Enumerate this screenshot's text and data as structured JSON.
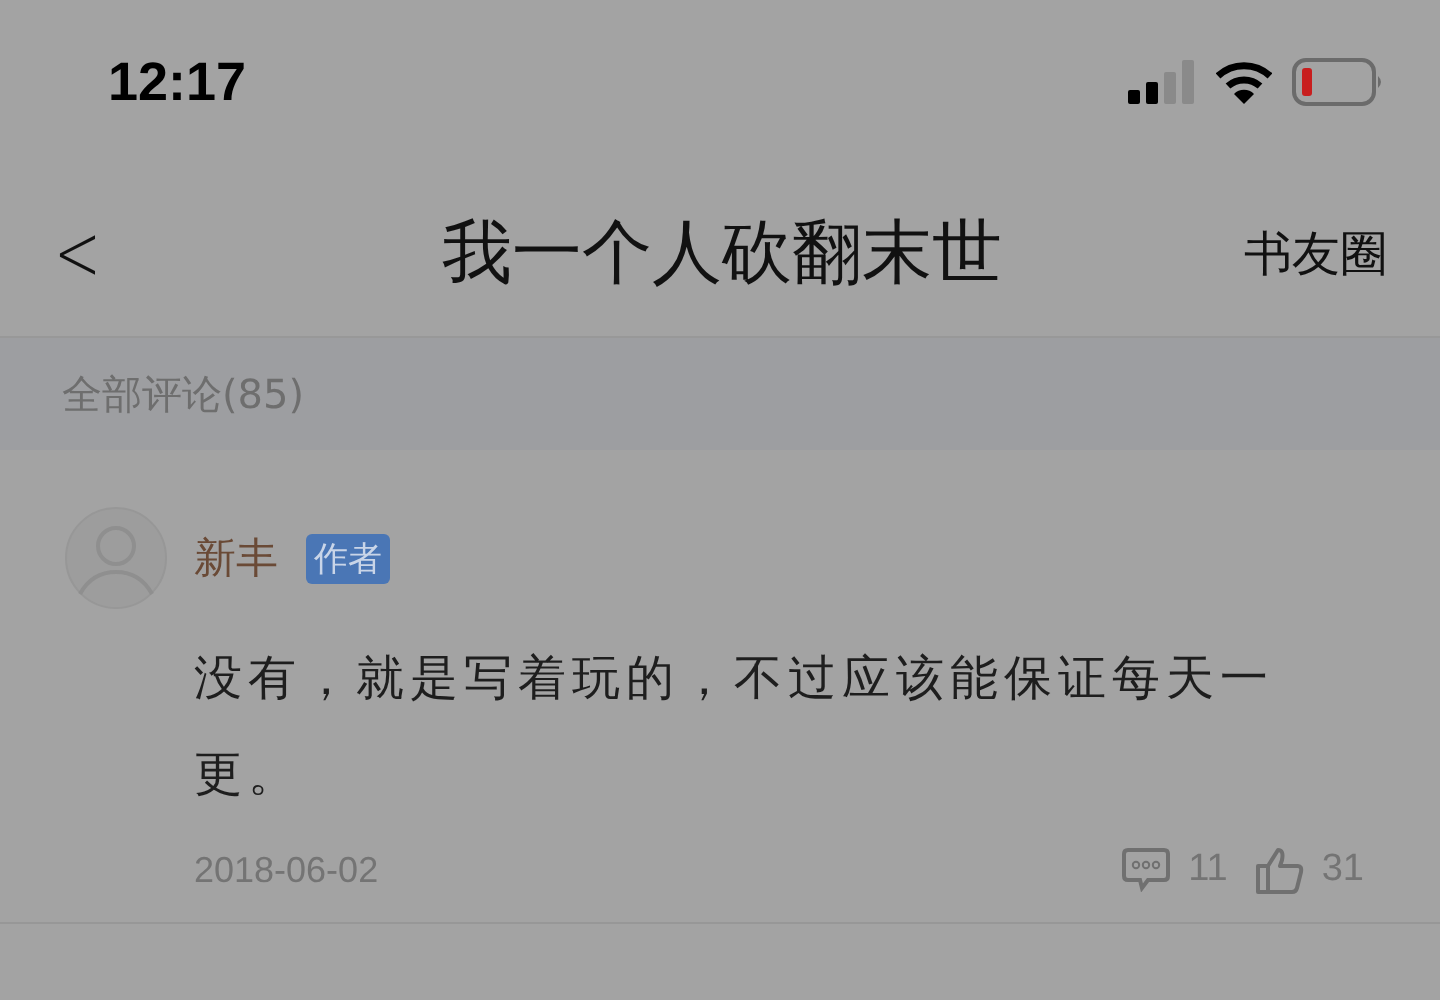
{
  "status_bar": {
    "time": "12:17"
  },
  "nav": {
    "back": "<",
    "title": "我一个人砍翻末世",
    "action": "书友圈"
  },
  "section": {
    "label": "全部评论(85)"
  },
  "comments": [
    {
      "author": "新丰",
      "badge": "作者",
      "text": "没有，就是写着玩的，不过应该能保证每天一更。",
      "date": "2018-06-02",
      "replies": "11",
      "likes": "31"
    }
  ]
}
